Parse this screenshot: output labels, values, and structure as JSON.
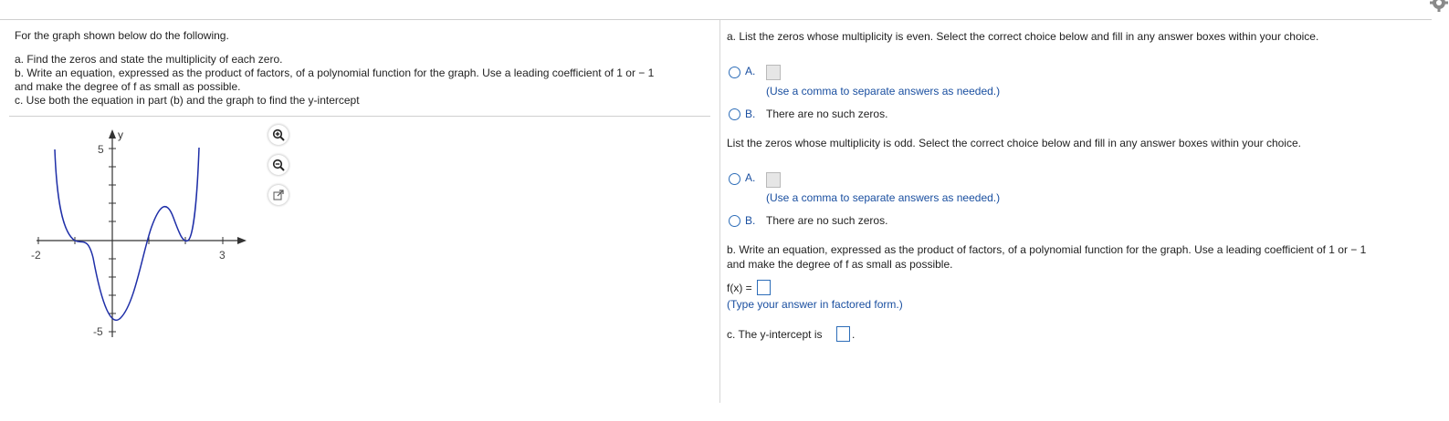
{
  "left": {
    "intro": "For the graph shown below do the following.",
    "tasks": [
      "a. Find the zeros and state the multiplicity of each zero.",
      "b. Write an equation, expressed as the product of factors, of a polynomial function for the graph. Use a leading coefficient of 1 or − 1",
      "and make the degree of f as small as possible.",
      "c. Use both the equation in part (b) and the graph to find the y-intercept"
    ]
  },
  "graph": {
    "y_axis_label": "y",
    "tick_labels": {
      "x_min": "-2",
      "x_max": "3",
      "y_max": "5",
      "y_min": "-5"
    },
    "x_range": [
      -2,
      3
    ],
    "y_range": [
      -5,
      5
    ],
    "curve_color": "#1f2fa8"
  },
  "tools": {
    "zoom_in": "zoom-in-icon",
    "zoom_out": "zoom-out-icon",
    "popout": "popout-icon"
  },
  "part_a": {
    "even_prompt": "a. List the zeros whose multiplicity is even. Select the correct choice below and fill in any answer boxes within your choice.",
    "even_choice_a": "A.",
    "even_hint": "(Use a comma to separate answers as needed.)",
    "even_choice_b": "B.",
    "even_choice_b_text": "There are no such zeros.",
    "odd_prompt": "List the zeros whose multiplicity is odd. Select the correct choice below and fill in any answer boxes within your choice.",
    "odd_choice_a": "A.",
    "odd_hint": "(Use a comma to separate answers as needed.)",
    "odd_choice_b": "B.",
    "odd_choice_b_text": "There are no such zeros."
  },
  "part_b": {
    "prompt_line1": "b. Write an equation, expressed as the product of factors, of a polynomial function for the graph. Use a leading coefficient of 1 or − 1",
    "prompt_line2": "and make the degree of f as small as possible.",
    "fx_label": "f(x) =",
    "hint": "(Type your answer in factored form.)"
  },
  "part_c": {
    "prompt": "c. The y-intercept is",
    "period": "."
  },
  "colors": {
    "accent": "#2d6db8",
    "link_text": "#1a4fa0"
  }
}
